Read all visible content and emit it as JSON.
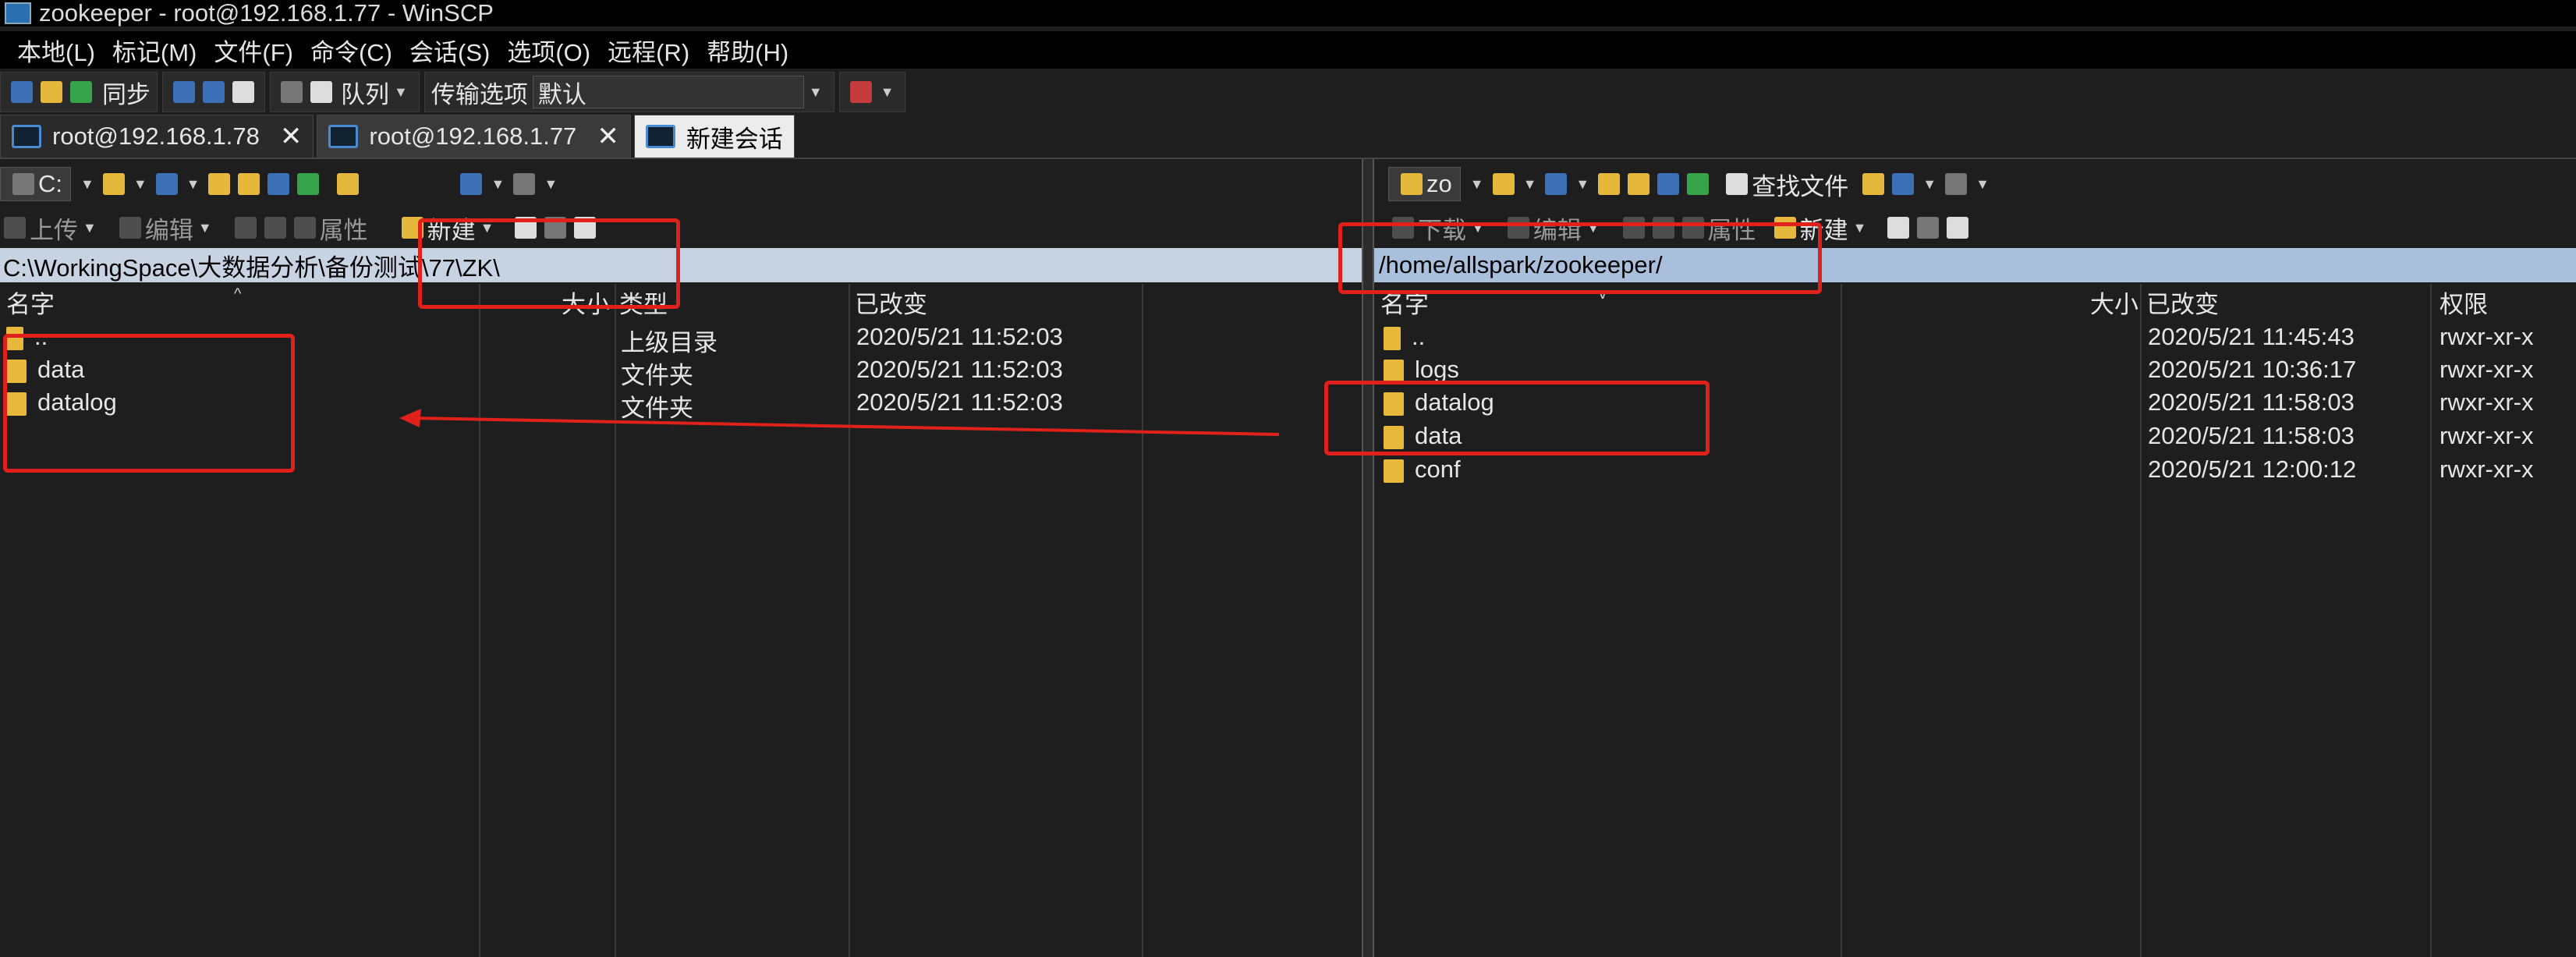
{
  "window": {
    "title": "zookeeper - root@192.168.1.77 - WinSCP"
  },
  "menu": [
    "本地(L)",
    "标记(M)",
    "文件(F)",
    "命令(C)",
    "会话(S)",
    "选项(O)",
    "远程(R)",
    "帮助(H)"
  ],
  "toolbar": {
    "sync_label": "同步",
    "queue_label": "队列",
    "transfer_options_label": "传输选项",
    "transfer_preset": "默认"
  },
  "tabs": [
    {
      "label": "root@192.168.1.78"
    },
    {
      "label": "root@192.168.1.77"
    }
  ],
  "new_session_label": "新建会话",
  "left": {
    "drive": "C:",
    "upload_label": "上传",
    "edit_label": "编辑",
    "properties_label": "属性",
    "new_label": "新建",
    "path": "C:\\WorkingSpace\\大数据分析\\备份测试\\77\\ZK\\",
    "columns": {
      "name": "名字",
      "size": "大小",
      "type": "类型",
      "modified": "已改变"
    },
    "rows": [
      {
        "name": "..",
        "type": "上级目录",
        "modified": "2020/5/21  11:52:03"
      },
      {
        "name": "data",
        "type": "文件夹",
        "modified": "2020/5/21  11:52:03"
      },
      {
        "name": "datalog",
        "type": "文件夹",
        "modified": "2020/5/21  11:52:03"
      }
    ]
  },
  "right": {
    "drive": "zo",
    "find_files_label": "查找文件",
    "download_label": "下载",
    "edit_label": "编辑",
    "properties_label": "属性",
    "new_label": "新建",
    "path": "/home/allspark/zookeeper/",
    "columns": {
      "name": "名字",
      "size": "大小",
      "modified": "已改变",
      "permissions": "权限"
    },
    "rows": [
      {
        "name": "..",
        "modified": "2020/5/21 11:45:43",
        "permissions": "rwxr-xr-x"
      },
      {
        "name": "logs",
        "modified": "2020/5/21 10:36:17",
        "permissions": "rwxr-xr-x"
      },
      {
        "name": "datalog",
        "modified": "2020/5/21 11:58:03",
        "permissions": "rwxr-xr-x"
      },
      {
        "name": "data",
        "modified": "2020/5/21 11:58:03",
        "permissions": "rwxr-xr-x"
      },
      {
        "name": "conf",
        "modified": "2020/5/21 12:00:12",
        "permissions": "rwxr-xr-x"
      }
    ]
  },
  "colors": {
    "annotation_red": "#e0201a",
    "left_path_bg": "#c7d3e3",
    "right_path_bg": "#aabfdc"
  }
}
